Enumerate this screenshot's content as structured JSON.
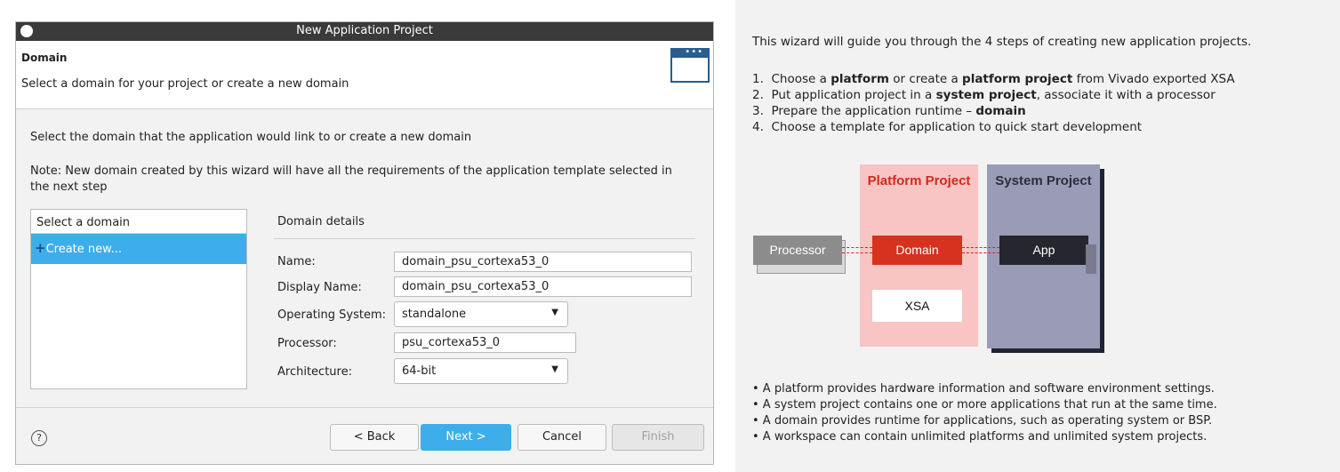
{
  "window": {
    "title": "New Application Project"
  },
  "header": {
    "title": "Domain",
    "subtitle": "Select a domain for your project or create a new domain"
  },
  "body": {
    "instruction": "Select the domain that the application would link to or create a new domain",
    "note_line1": "Note: New domain created by this wizard will have all the requirements of the application template selected in",
    "note_line2": "the next step"
  },
  "domain_list": {
    "header": "Select a domain",
    "items": [
      {
        "label": "Create new..."
      }
    ]
  },
  "details": {
    "title": "Domain details",
    "fields": [
      {
        "label": "Name:",
        "value": "domain_psu_cortexa53_0"
      },
      {
        "label": "Display Name:",
        "value": "domain_psu_cortexa53_0"
      },
      {
        "label": "Operating System:",
        "value": "standalone"
      },
      {
        "label": "Processor:",
        "value": "psu_cortexa53_0"
      },
      {
        "label": "Architecture:",
        "value": "64-bit"
      }
    ]
  },
  "footer": {
    "help": "?",
    "back": "< Back",
    "next": "Next >",
    "cancel": "Cancel",
    "finish": "Finish"
  },
  "info": {
    "intro": "This wizard will guide you through the 4 steps of creating new application projects.",
    "steps": [
      {
        "n": "1.",
        "p1": "Choose a ",
        "b1": "platform",
        "p2": " or create a ",
        "b2": "platform project",
        "p3": " from Vivado exported XSA"
      },
      {
        "n": "2.",
        "p1": "Put application project in a ",
        "b1": "system project",
        "p2": ", associate it with a processor"
      },
      {
        "n": "3.",
        "p1": "Prepare the application runtime – ",
        "b1": "domain"
      },
      {
        "n": "4.",
        "p1": "Choose a template for application to quick start development"
      }
    ],
    "diagram": {
      "platform_project": "Platform Project",
      "system_project": "System Project",
      "processor": "Processor",
      "domain": "Domain",
      "app": "App",
      "xsa": "XSA"
    },
    "bullets": [
      "• A platform provides hardware information and software environment settings.",
      "• A system project contains one or more applications that run at the same time.",
      "• A domain provides runtime for applications, such as operating system or BSP.",
      "• A workspace can contain unlimited platforms and unlimited system projects."
    ]
  },
  "colors": {
    "accent": "#3daee9",
    "platform_bg": "#f8c4c4",
    "platform_text": "#d4291f",
    "system_bg": "#9a9bb6",
    "domain_red": "#d6321f",
    "app_dark": "#26262e"
  }
}
